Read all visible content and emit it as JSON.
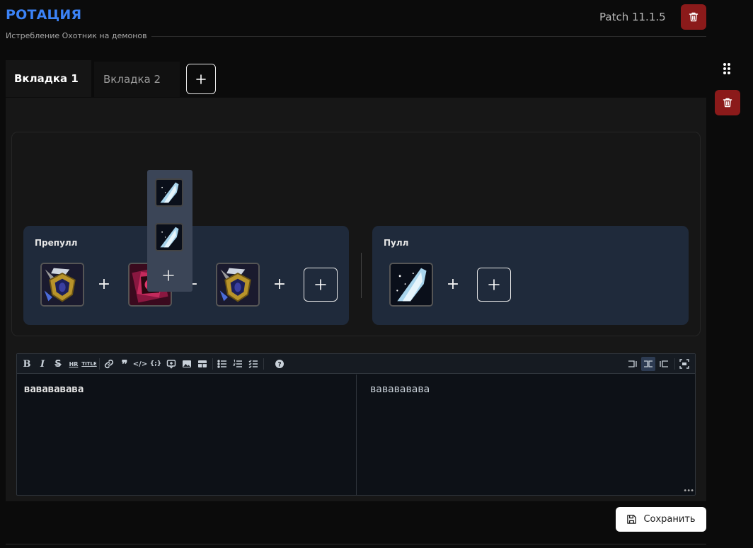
{
  "header": {
    "title": "РОТАЦИЯ",
    "subtitle": "Истребление Охотник на демонов",
    "patch": "Patch 11.1.5"
  },
  "tabs": [
    {
      "label": "Вкладка 1",
      "active": true
    },
    {
      "label": "Вкладка 2",
      "active": false
    }
  ],
  "groups": {
    "prepull": {
      "label": "Препулл",
      "icons": [
        "golden-shield-spell-icon",
        "crimson-sigil-spell-icon",
        "golden-shield-spell-icon"
      ]
    },
    "pull": {
      "label": "Пулл",
      "icons": [
        "ice-spike-spell-icon"
      ]
    }
  },
  "dropdown": {
    "icons": [
      "ice-spike-spell-icon",
      "ice-spike-spell-icon"
    ]
  },
  "editor": {
    "source_text": "вававававa",
    "preview_text": "вававававa"
  },
  "save": {
    "label": "Сохранить"
  },
  "colors": {
    "accent": "#3b82f6",
    "danger": "#8b1a1a",
    "group_bg": "#1f2a3b",
    "dropdown_bg": "#3b4557"
  }
}
